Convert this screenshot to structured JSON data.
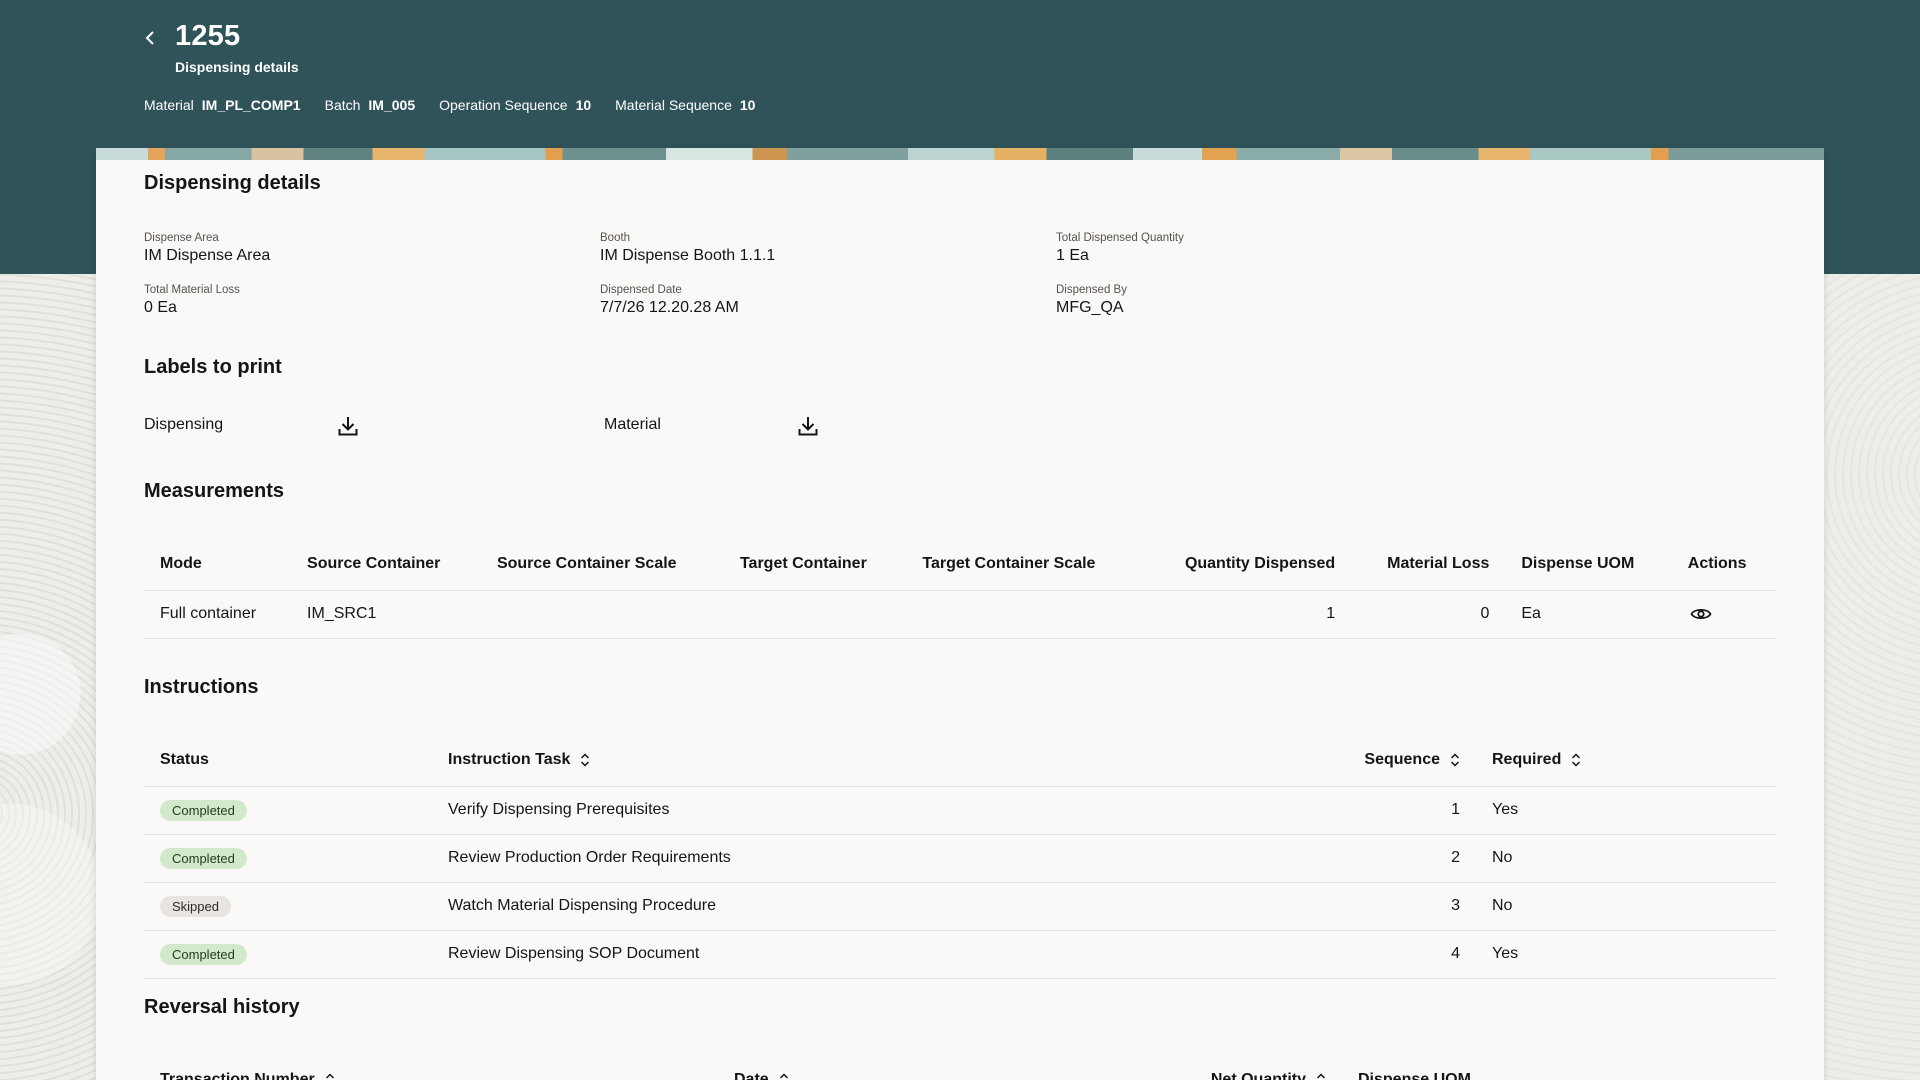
{
  "header": {
    "title": "1255",
    "subtitle": "Dispensing details",
    "meta": [
      {
        "key": "Material",
        "value": "IM_PL_COMP1"
      },
      {
        "key": "Batch",
        "value": "IM_005"
      },
      {
        "key": "Operation Sequence",
        "value": "10"
      },
      {
        "key": "Material Sequence",
        "value": "10"
      }
    ]
  },
  "details": {
    "title": "Dispensing details",
    "fields": [
      {
        "label": "Dispense Area",
        "value": "IM Dispense Area"
      },
      {
        "label": "Booth",
        "value": "IM Dispense Booth 1.1.1"
      },
      {
        "label": "Total Dispensed Quantity",
        "value": "1 Ea"
      },
      {
        "label": "Total Material Loss",
        "value": "0 Ea"
      },
      {
        "label": "Dispensed Date",
        "value": "7/7/26 12.20.28 AM"
      },
      {
        "label": "Dispensed By",
        "value": "MFG_QA"
      }
    ]
  },
  "labels": {
    "title": "Labels to print",
    "items": [
      {
        "label": "Dispensing",
        "icon": "download-icon"
      },
      {
        "label": "Material",
        "icon": "download-icon"
      }
    ]
  },
  "measurements": {
    "title": "Measurements",
    "columns": [
      "Mode",
      "Source Container",
      "Source Container Scale",
      "Target Container",
      "Target Container Scale",
      "Quantity Dispensed",
      "Material Loss",
      "Dispense UOM",
      "Actions"
    ],
    "rows": [
      {
        "mode": "Full container",
        "source_container": "IM_SRC1",
        "source_scale": "",
        "target_container": "",
        "target_scale": "",
        "quantity": "1",
        "loss": "0",
        "uom": "Ea",
        "action_icon": "eye-icon"
      }
    ]
  },
  "instructions": {
    "title": "Instructions",
    "columns": [
      "Status",
      "Instruction Task",
      "Sequence",
      "Required"
    ],
    "rows": [
      {
        "status": "Completed",
        "task": "Verify Dispensing Prerequisites",
        "sequence": "1",
        "required": "Yes"
      },
      {
        "status": "Completed",
        "task": "Review Production Order Requirements",
        "sequence": "2",
        "required": "No"
      },
      {
        "status": "Skipped",
        "task": "Watch Material Dispensing Procedure",
        "sequence": "3",
        "required": "No"
      },
      {
        "status": "Completed",
        "task": "Review Dispensing SOP Document",
        "sequence": "4",
        "required": "Yes"
      }
    ]
  },
  "reversal": {
    "title": "Reversal history",
    "columns": [
      "Transaction Number",
      "Date",
      "Net Quantity",
      "Dispense UOM"
    ]
  },
  "colors": {
    "header_bg": "#30535a",
    "completed_badge": "#d4e9cc",
    "skipped_badge": "#e8e5e1"
  }
}
